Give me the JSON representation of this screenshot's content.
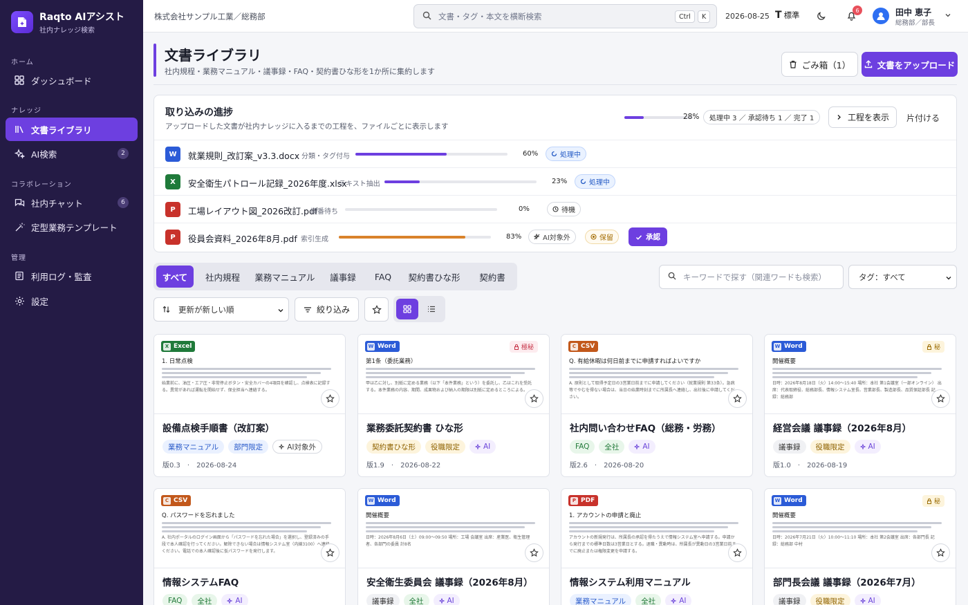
{
  "app": {
    "name": "Raqto AIアシスト",
    "subtitle": "社内ナレッジ検索"
  },
  "sidebar": {
    "groups": [
      {
        "label": "ホーム"
      },
      {
        "label": "ナレッジ"
      },
      {
        "label": "コラボレーション"
      },
      {
        "label": "管理"
      }
    ],
    "items": [
      {
        "label": "ダッシュボード",
        "icon": "grid-icon"
      },
      {
        "label": "文書ライブラリ",
        "icon": "library-icon",
        "active": true
      },
      {
        "label": "AI検索",
        "icon": "sparkle-icon",
        "badge": "2"
      },
      {
        "label": "社内チャット",
        "icon": "chat-icon",
        "badge": "6"
      },
      {
        "label": "定型業務テンプレート",
        "icon": "wand-icon"
      },
      {
        "label": "利用ログ・監査",
        "icon": "log-icon"
      },
      {
        "label": "設定",
        "icon": "gear-icon"
      }
    ]
  },
  "header": {
    "company": "株式会社サンプル工業／総務部",
    "search_placeholder": "文書・タグ・本文を横断検索",
    "shortcut": [
      "Ctrl",
      "K"
    ],
    "date": "2026-08-25",
    "font_size": "標準",
    "notif_count": "6",
    "user": {
      "name": "田中 恵子",
      "role": "総務部／部長"
    }
  },
  "page": {
    "title": "文書ライブラリ",
    "subtitle": "社内規程・業務マニュアル・議事録・FAQ・契約書ひな形を1か所に集約します",
    "trash_label": "ごみ箱（1）",
    "upload_label": "文書をアップロード"
  },
  "progress": {
    "title": "取り込みの進捗",
    "desc": "アップロードした文書が社内ナレッジに入るまでの工程を、ファイルごとに表示します",
    "overall_pct": 28,
    "overall_label": "28%",
    "stats": "処理中 3 ／ 承認待ち 1 ／ 完了 1",
    "show_steps": "工程を表示",
    "clear": "片付ける",
    "files": [
      {
        "type": "W",
        "color": "#2b5bd7",
        "name": "就業規則_改訂案_v3.3.docx",
        "step": "分類・タグ付与",
        "pct": 60,
        "pct_label": "60%",
        "bar": "#6d3fe0",
        "status": "処理中"
      },
      {
        "type": "X",
        "color": "#1f7a3a",
        "name": "安全衛生パトロール記録_2026年度.xlsx",
        "step": "テキスト抽出",
        "pct": 23,
        "pct_label": "23%",
        "bar": "#6d3fe0",
        "status": "処理中"
      },
      {
        "type": "P",
        "color": "#c8322b",
        "name": "工場レイアウト図_2026改訂.pdf",
        "step": "順番待ち",
        "pct": 0,
        "pct_label": "0%",
        "bar": "#6d3fe0",
        "status": "待機"
      },
      {
        "type": "P",
        "color": "#c8322b",
        "name": "役員会資料_2026年8月.pdf",
        "step": "索引生成",
        "pct": 83,
        "pct_label": "83%",
        "bar": "#d9822b",
        "ai_out": "AI対象外",
        "hold": "保留",
        "approve": "承認"
      }
    ]
  },
  "filters": {
    "tabs": [
      "すべて",
      "社内規程",
      "業務マニュアル",
      "議事録",
      "FAQ",
      "契約書ひな形",
      "契約書"
    ],
    "keyword_placeholder": "キーワードで探す（関連ワードも検索）",
    "tag_select": "タグ：すべて",
    "sort": "更新が新しい順",
    "filter_label": "絞り込み"
  },
  "cards": [
    {
      "ftype": "Excel",
      "fl": "X",
      "fcolor": "#1f7a3a",
      "heading": "1. 日常点検",
      "body": "始業前に、油圧・エア圧・非常停止ボタン・安全カバーの4項目を確認し、点検表に記録する。異常があれば運転を開始せず、保全担当へ連絡する。",
      "title": "設備点検手順書（改訂案）",
      "tags": [
        {
          "text": "業務マニュアル",
          "cls": "t-blue"
        },
        {
          "text": "部門限定",
          "cls": "t-blue"
        },
        {
          "text": "AI対象外",
          "cls": "t-out"
        }
      ],
      "version": "版0.3",
      "date": "2026-08-24"
    },
    {
      "ftype": "Word",
      "fl": "W",
      "fcolor": "#2b5bd7",
      "secret": "極秘",
      "secret_cls": "sec-red",
      "heading": "第1条（委託業務）",
      "body": "甲は乙に対し、別紙に定める業務（以下「本件業務」という）を委託し、乙はこれを受託する。本件業務の内容、期間、成果物および納入の期限は別紙に定めるところによる。",
      "title": "業務委託契約書 ひな形",
      "tags": [
        {
          "text": "契約書ひな形",
          "cls": "t-yel"
        },
        {
          "text": "役職限定",
          "cls": "t-yel"
        },
        {
          "text": "AI",
          "cls": "t-ai"
        }
      ],
      "version": "版1.9",
      "date": "2026-08-22"
    },
    {
      "ftype": "CSV",
      "fl": "C",
      "fcolor": "#c2581b",
      "heading": "Q. 有給休暇は何日前までに申請すればよいですか",
      "body": "A. 原則として取得予定日の3営業日前までに申請してください（就業規則 第33条）。急病等でやむを得ない場合は、当日の始業時刻までに所属長へ連絡し、出社後に申請してください。",
      "title": "社内問い合わせFAQ（総務・労務）",
      "tags": [
        {
          "text": "FAQ",
          "cls": "t-green"
        },
        {
          "text": "全社",
          "cls": "t-green"
        },
        {
          "text": "AI",
          "cls": "t-ai"
        }
      ],
      "version": "版2.6",
      "date": "2026-08-20"
    },
    {
      "ftype": "Word",
      "fl": "W",
      "fcolor": "#2b5bd7",
      "secret": "秘",
      "secret_cls": "sec-yel",
      "heading": "開催概要",
      "body": "日時：2026年8月18日（火）14:00〜15:40 場所：本社 第1会議室（一部オンライン） 出席：代表取締役、総務部長、情報システム室長、営業部長、製造部長、品質保証部長 記録：総務部",
      "title": "経営会議 議事録（2026年8月）",
      "tags": [
        {
          "text": "議事録",
          "cls": "t-gray"
        },
        {
          "text": "役職限定",
          "cls": "t-yel"
        },
        {
          "text": "AI",
          "cls": "t-ai"
        }
      ],
      "version": "版1.0",
      "date": "2026-08-19"
    },
    {
      "ftype": "CSV",
      "fl": "C",
      "fcolor": "#c2581b",
      "heading": "Q. パスワードを忘れました",
      "body": "A. 社内ポータルのログイン画面から「パスワードを忘れた場合」を選択し、登録済みの手段で本人確認を行ってください。解除できない場合は情報システム室（内線3100）へ連絡ください。電話での本人確認後に仮パスワードを発行します。",
      "title": "情報システムFAQ",
      "tags": [
        {
          "text": "FAQ",
          "cls": "t-green"
        },
        {
          "text": "全社",
          "cls": "t-green"
        },
        {
          "text": "AI",
          "cls": "t-ai"
        }
      ],
      "version": "",
      "date": ""
    },
    {
      "ftype": "Word",
      "fl": "W",
      "fcolor": "#2b5bd7",
      "heading": "開催概要",
      "body": "日時：2026年8月6日（土）09:00〜09:50 場所：工場 会議室 出席：産業医、衛生管理者、各部門の委員 計8名",
      "title": "安全衛生委員会 議事録（2026年8月）",
      "tags": [
        {
          "text": "議事録",
          "cls": "t-gray"
        },
        {
          "text": "全社",
          "cls": "t-green"
        },
        {
          "text": "AI",
          "cls": "t-ai"
        }
      ],
      "version": "",
      "date": ""
    },
    {
      "ftype": "PDF",
      "fl": "P",
      "fcolor": "#c8322b",
      "heading": "1. アカウントの申請と廃止",
      "body": "アカウントの新規発行は、所属長の承認を得たうえで情報システム室へ申請する。申請から発行までの標準日数は3営業日とする。退職・異動時は、所属長が異動日の3営業日前までに廃止または権限変更を申請する。",
      "title": "情報システム利用マニュアル",
      "tags": [
        {
          "text": "業務マニュアル",
          "cls": "t-blue"
        },
        {
          "text": "全社",
          "cls": "t-green"
        },
        {
          "text": "AI",
          "cls": "t-ai"
        }
      ],
      "version": "",
      "date": ""
    },
    {
      "ftype": "Word",
      "fl": "W",
      "fcolor": "#2b5bd7",
      "secret": "秘",
      "secret_cls": "sec-yel",
      "heading": "開催概要",
      "body": "日時：2026年7月21日（火）10:00〜11:10 場所：本社 第2会議室 出席：各部門長 記録：総務部 中村",
      "title": "部門長会議 議事録（2026年7月）",
      "tags": [
        {
          "text": "議事録",
          "cls": "t-gray"
        },
        {
          "text": "役職限定",
          "cls": "t-yel"
        },
        {
          "text": "AI",
          "cls": "t-ai"
        }
      ],
      "version": "",
      "date": ""
    }
  ]
}
